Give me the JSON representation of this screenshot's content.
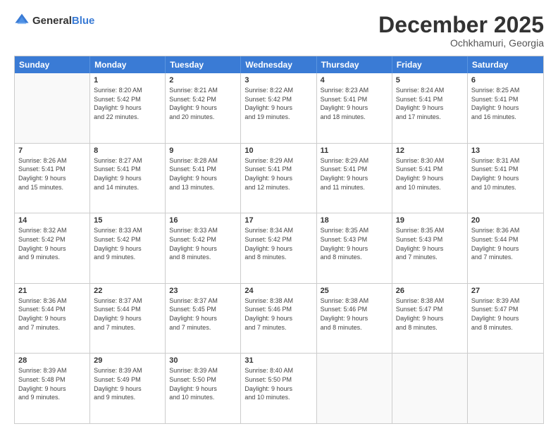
{
  "logo": {
    "general": "General",
    "blue": "Blue"
  },
  "title": "December 2025",
  "location": "Ochkhamuri, Georgia",
  "header_days": [
    "Sunday",
    "Monday",
    "Tuesday",
    "Wednesday",
    "Thursday",
    "Friday",
    "Saturday"
  ],
  "rows": [
    [
      {
        "day": "",
        "lines": []
      },
      {
        "day": "1",
        "lines": [
          "Sunrise: 8:20 AM",
          "Sunset: 5:42 PM",
          "Daylight: 9 hours",
          "and 22 minutes."
        ]
      },
      {
        "day": "2",
        "lines": [
          "Sunrise: 8:21 AM",
          "Sunset: 5:42 PM",
          "Daylight: 9 hours",
          "and 20 minutes."
        ]
      },
      {
        "day": "3",
        "lines": [
          "Sunrise: 8:22 AM",
          "Sunset: 5:42 PM",
          "Daylight: 9 hours",
          "and 19 minutes."
        ]
      },
      {
        "day": "4",
        "lines": [
          "Sunrise: 8:23 AM",
          "Sunset: 5:41 PM",
          "Daylight: 9 hours",
          "and 18 minutes."
        ]
      },
      {
        "day": "5",
        "lines": [
          "Sunrise: 8:24 AM",
          "Sunset: 5:41 PM",
          "Daylight: 9 hours",
          "and 17 minutes."
        ]
      },
      {
        "day": "6",
        "lines": [
          "Sunrise: 8:25 AM",
          "Sunset: 5:41 PM",
          "Daylight: 9 hours",
          "and 16 minutes."
        ]
      }
    ],
    [
      {
        "day": "7",
        "lines": [
          "Sunrise: 8:26 AM",
          "Sunset: 5:41 PM",
          "Daylight: 9 hours",
          "and 15 minutes."
        ]
      },
      {
        "day": "8",
        "lines": [
          "Sunrise: 8:27 AM",
          "Sunset: 5:41 PM",
          "Daylight: 9 hours",
          "and 14 minutes."
        ]
      },
      {
        "day": "9",
        "lines": [
          "Sunrise: 8:28 AM",
          "Sunset: 5:41 PM",
          "Daylight: 9 hours",
          "and 13 minutes."
        ]
      },
      {
        "day": "10",
        "lines": [
          "Sunrise: 8:29 AM",
          "Sunset: 5:41 PM",
          "Daylight: 9 hours",
          "and 12 minutes."
        ]
      },
      {
        "day": "11",
        "lines": [
          "Sunrise: 8:29 AM",
          "Sunset: 5:41 PM",
          "Daylight: 9 hours",
          "and 11 minutes."
        ]
      },
      {
        "day": "12",
        "lines": [
          "Sunrise: 8:30 AM",
          "Sunset: 5:41 PM",
          "Daylight: 9 hours",
          "and 10 minutes."
        ]
      },
      {
        "day": "13",
        "lines": [
          "Sunrise: 8:31 AM",
          "Sunset: 5:41 PM",
          "Daylight: 9 hours",
          "and 10 minutes."
        ]
      }
    ],
    [
      {
        "day": "14",
        "lines": [
          "Sunrise: 8:32 AM",
          "Sunset: 5:42 PM",
          "Daylight: 9 hours",
          "and 9 minutes."
        ]
      },
      {
        "day": "15",
        "lines": [
          "Sunrise: 8:33 AM",
          "Sunset: 5:42 PM",
          "Daylight: 9 hours",
          "and 9 minutes."
        ]
      },
      {
        "day": "16",
        "lines": [
          "Sunrise: 8:33 AM",
          "Sunset: 5:42 PM",
          "Daylight: 9 hours",
          "and 8 minutes."
        ]
      },
      {
        "day": "17",
        "lines": [
          "Sunrise: 8:34 AM",
          "Sunset: 5:42 PM",
          "Daylight: 9 hours",
          "and 8 minutes."
        ]
      },
      {
        "day": "18",
        "lines": [
          "Sunrise: 8:35 AM",
          "Sunset: 5:43 PM",
          "Daylight: 9 hours",
          "and 8 minutes."
        ]
      },
      {
        "day": "19",
        "lines": [
          "Sunrise: 8:35 AM",
          "Sunset: 5:43 PM",
          "Daylight: 9 hours",
          "and 7 minutes."
        ]
      },
      {
        "day": "20",
        "lines": [
          "Sunrise: 8:36 AM",
          "Sunset: 5:44 PM",
          "Daylight: 9 hours",
          "and 7 minutes."
        ]
      }
    ],
    [
      {
        "day": "21",
        "lines": [
          "Sunrise: 8:36 AM",
          "Sunset: 5:44 PM",
          "Daylight: 9 hours",
          "and 7 minutes."
        ]
      },
      {
        "day": "22",
        "lines": [
          "Sunrise: 8:37 AM",
          "Sunset: 5:44 PM",
          "Daylight: 9 hours",
          "and 7 minutes."
        ]
      },
      {
        "day": "23",
        "lines": [
          "Sunrise: 8:37 AM",
          "Sunset: 5:45 PM",
          "Daylight: 9 hours",
          "and 7 minutes."
        ]
      },
      {
        "day": "24",
        "lines": [
          "Sunrise: 8:38 AM",
          "Sunset: 5:46 PM",
          "Daylight: 9 hours",
          "and 7 minutes."
        ]
      },
      {
        "day": "25",
        "lines": [
          "Sunrise: 8:38 AM",
          "Sunset: 5:46 PM",
          "Daylight: 9 hours",
          "and 8 minutes."
        ]
      },
      {
        "day": "26",
        "lines": [
          "Sunrise: 8:38 AM",
          "Sunset: 5:47 PM",
          "Daylight: 9 hours",
          "and 8 minutes."
        ]
      },
      {
        "day": "27",
        "lines": [
          "Sunrise: 8:39 AM",
          "Sunset: 5:47 PM",
          "Daylight: 9 hours",
          "and 8 minutes."
        ]
      }
    ],
    [
      {
        "day": "28",
        "lines": [
          "Sunrise: 8:39 AM",
          "Sunset: 5:48 PM",
          "Daylight: 9 hours",
          "and 9 minutes."
        ]
      },
      {
        "day": "29",
        "lines": [
          "Sunrise: 8:39 AM",
          "Sunset: 5:49 PM",
          "Daylight: 9 hours",
          "and 9 minutes."
        ]
      },
      {
        "day": "30",
        "lines": [
          "Sunrise: 8:39 AM",
          "Sunset: 5:50 PM",
          "Daylight: 9 hours",
          "and 10 minutes."
        ]
      },
      {
        "day": "31",
        "lines": [
          "Sunrise: 8:40 AM",
          "Sunset: 5:50 PM",
          "Daylight: 9 hours",
          "and 10 minutes."
        ]
      },
      {
        "day": "",
        "lines": []
      },
      {
        "day": "",
        "lines": []
      },
      {
        "day": "",
        "lines": []
      }
    ]
  ]
}
